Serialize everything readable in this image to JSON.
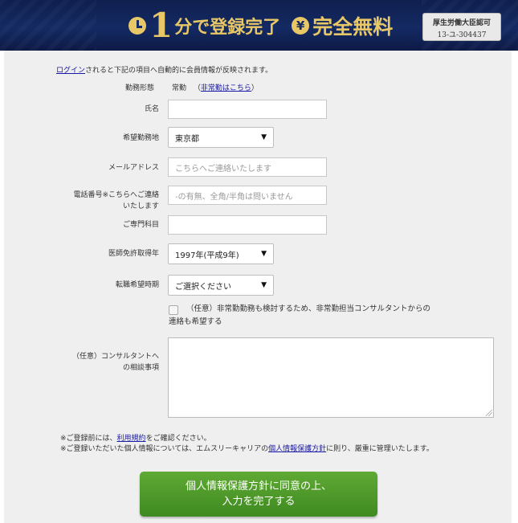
{
  "banner": {
    "big_number": "1",
    "text_minutes": "分で登録完了",
    "text_free": "完全無料",
    "clock_icon": "clock-icon",
    "yen_icon": "yen-icon",
    "license_line1": "厚生労働大臣認可",
    "license_line2": "13-ユ-304437"
  },
  "lead": {
    "login_link": "ログイン",
    "rest": "されると下記の項目へ自動的に会員情報が反映されます。"
  },
  "form": {
    "employment_label": "勤務形態",
    "employment_value": "常勤",
    "employment_link_open": "（",
    "employment_link": "非常勤はこちら",
    "employment_link_close": "）",
    "name_label": "氏名",
    "name_value": "",
    "location_label": "希望勤務地",
    "location_value": "東京都",
    "email_label": "メールアドレス",
    "email_placeholder": "こちらへご連絡いたします",
    "phone_label_1": "電話番号※こちらへご連絡",
    "phone_label_2": "いたします",
    "phone_placeholder": "-の有無、全角/半角は問いません",
    "specialty_label": "ご専門科目",
    "specialty_value": "",
    "license_year_label": "医師免許取得年",
    "license_year_value": "1997年(平成9年)",
    "timing_label": "転職希望時期",
    "timing_value": "ご選択ください",
    "checkbox_text": "（任意）非常勤勤務も検討するため、非常勤担当コンサルタントからの連絡も希望する",
    "consult_label_1": "（任意）コンサルタントへ",
    "consult_label_2": "の相談事項",
    "consult_value": ""
  },
  "notes": {
    "line1_prefix": "※ご登録前には、",
    "line1_link": "利用規約",
    "line1_suffix": "をご確認ください。",
    "line2_prefix": "※ご登録いただいた個人情報については、エムスリーキャリアの",
    "line2_link": "個人情報保護方針",
    "line2_suffix": "に則り、厳重に管理いたします。"
  },
  "submit": {
    "line1": "個人情報保護方針に同意の上、",
    "line2": "入力を完了する"
  }
}
